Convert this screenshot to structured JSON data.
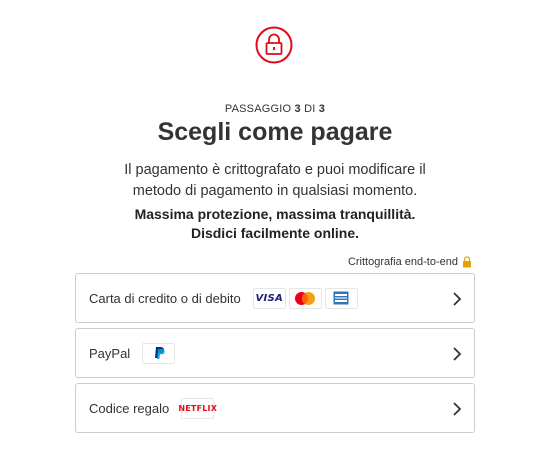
{
  "header": {
    "icon": "lock-icon",
    "step_prefix": "PASSAGGIO",
    "step_current": "3",
    "step_of": "DI",
    "step_total": "3",
    "title": "Scegli come pagare"
  },
  "description": {
    "line1": "Il pagamento è crittografato e puoi modificare il",
    "line2": "metodo di pagamento in qualsiasi momento."
  },
  "assurance": {
    "line1": "Massima protezione, massima tranquillità.",
    "line2": "Disdici facilmente online."
  },
  "encryption": {
    "label": "Crittografia end-to-end",
    "icon": "small-lock-icon"
  },
  "options": [
    {
      "label": "Carta di credito o di debito",
      "logos": [
        "VISA",
        "mastercard-icon",
        "amex-icon"
      ]
    },
    {
      "label": "PayPal",
      "logos": [
        "paypal-icon"
      ]
    },
    {
      "label": "Codice regalo",
      "logos": [
        "NETFLIX"
      ]
    }
  ],
  "colors": {
    "accent": "#e50914",
    "lock_gold": "#e5a00d",
    "visa_blue": "#1a1f71",
    "paypal_blue": "#003087",
    "amex_blue": "#2e77bc",
    "border": "#cccccc"
  }
}
